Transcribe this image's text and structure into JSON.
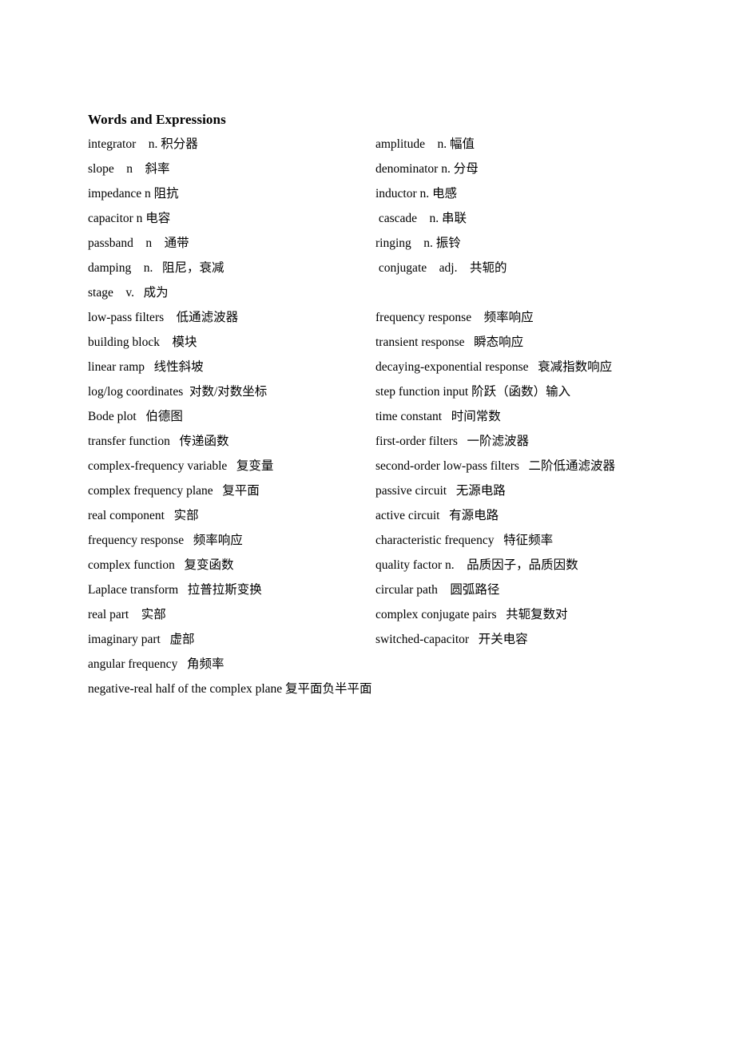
{
  "document": {
    "title": "Words and Expressions"
  },
  "glossary": {
    "rows": [
      {
        "left": "integrator    n. 积分器",
        "right": "amplitude    n. 幅值"
      },
      {
        "left": "slope    n    斜率",
        "right": "denominator n. 分母"
      },
      {
        "left": "impedance n 阻抗",
        "right": "inductor n. 电感"
      },
      {
        "left": "capacitor n 电容",
        "right": " cascade    n. 串联"
      },
      {
        "left": "passband    n    通带",
        "right": "ringing    n. 振铃"
      },
      {
        "left": "damping    n.   阻尼，衰减",
        "right": " conjugate    adj.    共轭的"
      },
      {
        "left": "stage    v.   成为",
        "right": ""
      },
      {
        "left": "low-pass filters    低通滤波器",
        "right": "frequency response    频率响应"
      },
      {
        "left": "building block    模块",
        "right": "transient response   瞬态响应"
      },
      {
        "left": "linear ramp   线性斜坡",
        "right": "decaying-exponential response   衰减指数响应"
      },
      {
        "left": "log/log coordinates  对数/对数坐标",
        "right": "step function input 阶跃（函数）输入"
      },
      {
        "left": "Bode plot   伯德图",
        "right": "time constant   时间常数"
      },
      {
        "left": "transfer function   传递函数",
        "right": "first-order filters   一阶滤波器"
      },
      {
        "left": "complex-frequency variable   复变量",
        "right": "second-order low-pass filters   二阶低通滤波器"
      },
      {
        "left": "complex frequency plane   复平面",
        "right": "passive circuit   无源电路"
      },
      {
        "left": "real component   实部",
        "right": "active circuit   有源电路"
      },
      {
        "left": "frequency response   频率响应",
        "right": "characteristic frequency   特征频率"
      },
      {
        "left": "complex function   复变函数",
        "right": "quality factor n.    品质因子，品质因数"
      },
      {
        "left": "Laplace transform   拉普拉斯变换",
        "right": "circular path    圆弧路径"
      },
      {
        "left": "real part    实部",
        "right": "complex conjugate pairs   共轭复数对"
      },
      {
        "left": "imaginary part   虚部",
        "right": "switched-capacitor   开关电容"
      },
      {
        "left": "angular frequency   角频率",
        "right": ""
      }
    ],
    "final_row": "negative-real half of the complex plane 复平面负半平面"
  }
}
